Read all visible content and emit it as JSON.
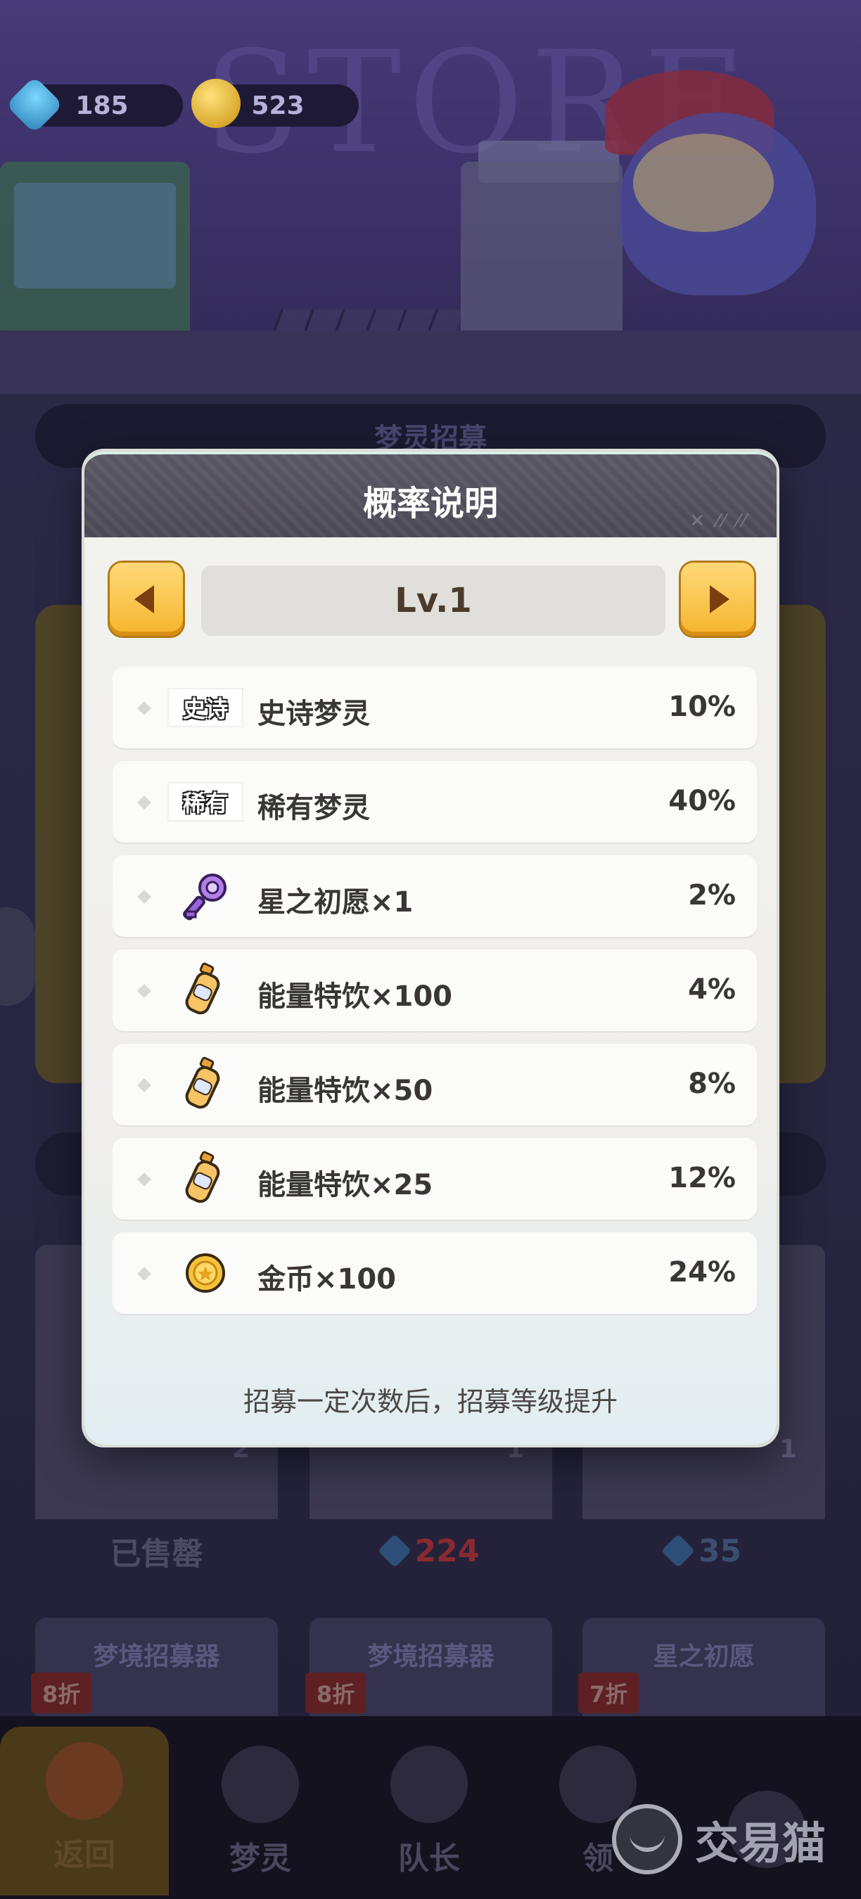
{
  "background": {
    "store_sign": "STORE",
    "currencies": {
      "gems": "185",
      "coins": "523"
    },
    "recruit_title": "梦灵招募",
    "shop_cards": [
      {
        "status": "已售罄",
        "count": "2"
      },
      {
        "price": "224",
        "count": "1"
      },
      {
        "price": "35",
        "count": "1"
      }
    ],
    "offers": [
      {
        "title": "梦境招募器",
        "discount": "8折"
      },
      {
        "title": "梦境招募器",
        "discount": "8折"
      },
      {
        "title": "星之初愿",
        "discount": "7折"
      }
    ]
  },
  "bottom_nav": {
    "back": "返回",
    "spirit": "梦灵",
    "captain": "队长",
    "claim": "领"
  },
  "watermark": "交易猫",
  "modal": {
    "title": "概率说明",
    "level": "Lv.1",
    "rows": [
      {
        "tag": "史诗",
        "label": "史诗梦灵",
        "percent": "10%",
        "icon": "epic-tag-icon"
      },
      {
        "tag": "稀有",
        "label": "稀有梦灵",
        "percent": "40%",
        "icon": "rare-tag-icon"
      },
      {
        "label": "星之初愿×1",
        "percent": "2%",
        "icon": "star-key-icon"
      },
      {
        "label": "能量特饮×100",
        "percent": "4%",
        "icon": "energy-drink-icon"
      },
      {
        "label": "能量特饮×50",
        "percent": "8%",
        "icon": "energy-drink-icon"
      },
      {
        "label": "能量特饮×25",
        "percent": "12%",
        "icon": "energy-drink-icon"
      },
      {
        "label": "金币×100",
        "percent": "24%",
        "icon": "gold-coin-icon"
      }
    ],
    "footer_note": "招募一定次数后，招募等级提升"
  },
  "colors": {
    "accent_gold": "#f5b52c",
    "header_dark": "#4c4956",
    "modal_bg": "#f2f2ef",
    "text_dark": "#3a3634"
  }
}
